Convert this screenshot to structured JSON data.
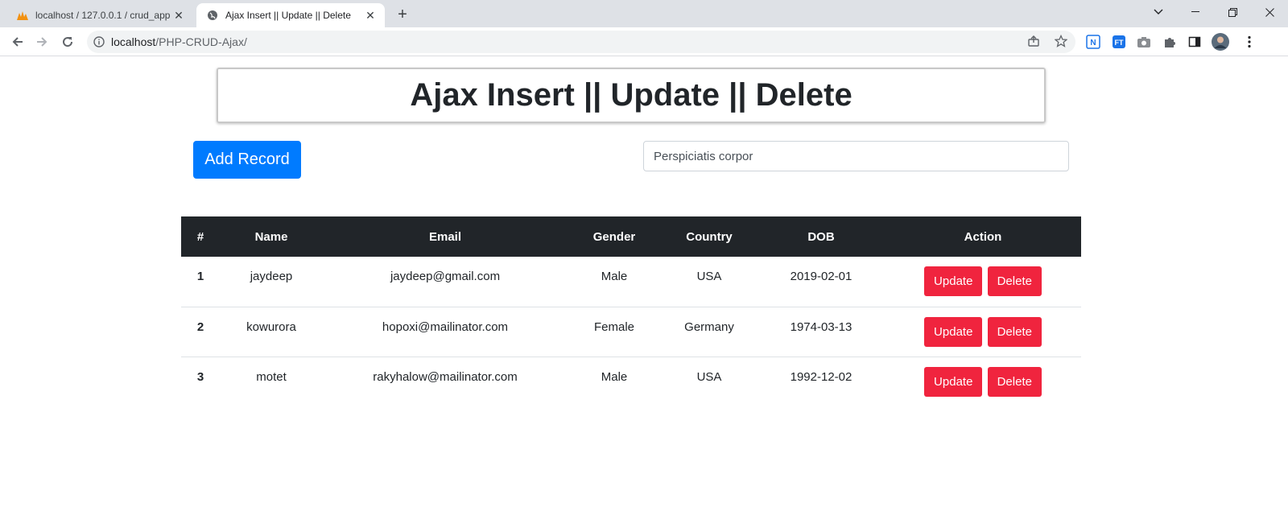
{
  "browser": {
    "tabs": [
      {
        "title": "localhost / 127.0.0.1 / crud_app | ",
        "active": false,
        "icon": "phpmyadmin-icon"
      },
      {
        "title": "Ajax Insert || Update || Delete",
        "active": true,
        "icon": "globe-icon"
      }
    ],
    "url_host": "localhost",
    "url_path": "/PHP-CRUD-Ajax/"
  },
  "page": {
    "heading": "Ajax Insert || Update || Delete",
    "add_button_label": "Add Record",
    "search_value": "Perspiciatis corpor"
  },
  "table": {
    "headers": [
      "#",
      "Name",
      "Email",
      "Gender",
      "Country",
      "DOB",
      "Action"
    ],
    "rows": [
      {
        "idx": "1",
        "name": "jaydeep",
        "email": "jaydeep@gmail.com",
        "gender": "Male",
        "country": "USA",
        "dob": "2019-02-01",
        "update": "Update",
        "delete": "Delete"
      },
      {
        "idx": "2",
        "name": "kowurora",
        "email": "hopoxi@mailinator.com",
        "gender": "Female",
        "country": "Germany",
        "dob": "1974-03-13",
        "update": "Update",
        "delete": "Delete"
      },
      {
        "idx": "3",
        "name": "motet",
        "email": "rakyhalow@mailinator.com",
        "gender": "Male",
        "country": "USA",
        "dob": "1992-12-02",
        "update": "Update",
        "delete": "Delete"
      }
    ]
  },
  "colors": {
    "primary": "#007bff",
    "danger": "#f0243e",
    "table_head": "#212529"
  }
}
